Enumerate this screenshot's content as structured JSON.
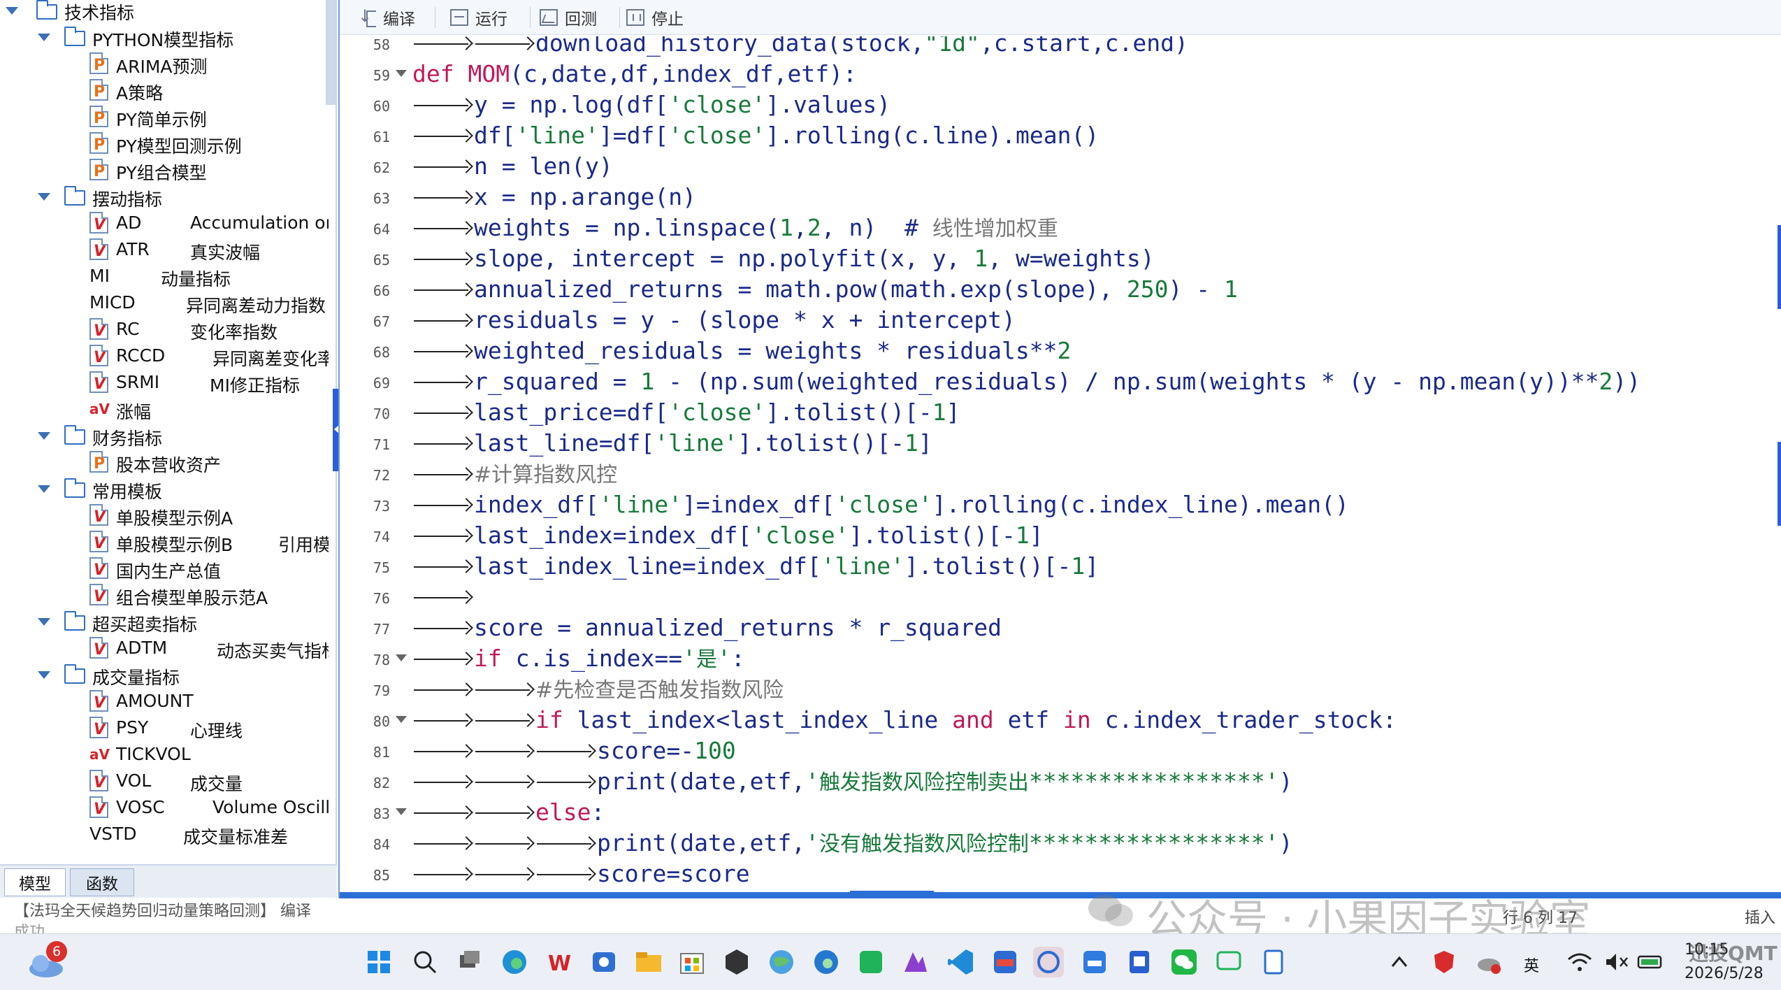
{
  "tree": {
    "root": "技术指标",
    "items": [
      {
        "kind": "folder",
        "level": 1,
        "label": "PYTHON模型指标"
      },
      {
        "kind": "file",
        "icon": "P",
        "label": "ARIMA预测"
      },
      {
        "kind": "file",
        "icon": "P",
        "label": "A策略"
      },
      {
        "kind": "file",
        "icon": "P",
        "label": "PY简单示例"
      },
      {
        "kind": "file",
        "icon": "P",
        "label": "PY模型回测示例"
      },
      {
        "kind": "file",
        "icon": "P",
        "label": "PY组合模型"
      },
      {
        "kind": "folder",
        "level": 1,
        "label": "摆动指标"
      },
      {
        "kind": "file",
        "icon": "V",
        "label": "AD",
        "desc": "Accumulation or"
      },
      {
        "kind": "file",
        "icon": "V",
        "label": "ATR",
        "desc": "真实波幅"
      },
      {
        "kind": "plain",
        "label": "MI",
        "desc": "动量指标"
      },
      {
        "kind": "plain",
        "label": "MICD",
        "desc": "异同离差动力指数"
      },
      {
        "kind": "file",
        "icon": "V",
        "label": "RC",
        "desc": "变化率指数"
      },
      {
        "kind": "file",
        "icon": "V",
        "label": "RCCD",
        "desc": "异同离差变化率"
      },
      {
        "kind": "file",
        "icon": "V",
        "label": "SRMI",
        "desc": "MI修正指标"
      },
      {
        "kind": "file",
        "icon": "aV",
        "label": "涨幅"
      },
      {
        "kind": "folder",
        "level": 1,
        "label": "财务指标"
      },
      {
        "kind": "file",
        "icon": "P",
        "label": "股本营收资产"
      },
      {
        "kind": "folder",
        "level": 1,
        "label": "常用模板"
      },
      {
        "kind": "file",
        "icon": "V",
        "label": "单股模型示例A"
      },
      {
        "kind": "file",
        "icon": "V",
        "label": "单股模型示例B",
        "desc": "引用模"
      },
      {
        "kind": "file",
        "icon": "V",
        "label": "国内生产总值"
      },
      {
        "kind": "file",
        "icon": "V",
        "label": "组合模型单股示范A"
      },
      {
        "kind": "folder",
        "level": 1,
        "label": "超买超卖指标"
      },
      {
        "kind": "file",
        "icon": "V",
        "label": "ADTM",
        "desc": "动态买卖气指标"
      },
      {
        "kind": "folder",
        "level": 1,
        "label": "成交量指标"
      },
      {
        "kind": "file",
        "icon": "V",
        "label": "AMOUNT"
      },
      {
        "kind": "file",
        "icon": "V",
        "label": "PSY",
        "desc": "心理线"
      },
      {
        "kind": "file",
        "icon": "aV",
        "label": "TICKVOL"
      },
      {
        "kind": "file",
        "icon": "V",
        "label": "VOL",
        "desc": "成交量"
      },
      {
        "kind": "file",
        "icon": "V",
        "label": "VOSC",
        "desc": "Volume Oscilla"
      },
      {
        "kind": "plain",
        "label": "VSTD",
        "desc": "成交量标准差"
      }
    ]
  },
  "left_tabs": [
    "模型",
    "函数"
  ],
  "toolbar": {
    "compile": "编译",
    "run": "运行",
    "backtest": "回测",
    "stop": "停止"
  },
  "code": [
    {
      "n": "58",
      "indent": 2,
      "text": "download_history_data(stock,\"1d\",c.start,c.end)"
    },
    {
      "n": "59",
      "indent": 0,
      "fold": true,
      "text": "def MOM(c,date,df,index_df,etf):"
    },
    {
      "n": "60",
      "indent": 1,
      "text": "y = np.log(df['close'].values)"
    },
    {
      "n": "61",
      "indent": 1,
      "text": "df['line']=df['close'].rolling(c.line).mean()"
    },
    {
      "n": "62",
      "indent": 1,
      "text": "n = len(y)"
    },
    {
      "n": "63",
      "indent": 1,
      "text": "x = np.arange(n)"
    },
    {
      "n": "64",
      "indent": 1,
      "text": "weights = np.linspace(1,2, n)  # ",
      "comment": "线性增加权重"
    },
    {
      "n": "65",
      "indent": 1,
      "text": "slope, intercept = np.polyfit(x, y, 1, w=weights)"
    },
    {
      "n": "66",
      "indent": 1,
      "text": "annualized_returns = math.pow(math.exp(slope), 250) - 1"
    },
    {
      "n": "67",
      "indent": 1,
      "text": "residuals = y - (slope * x + intercept)"
    },
    {
      "n": "68",
      "indent": 1,
      "text": "weighted_residuals = weights * residuals**2"
    },
    {
      "n": "69",
      "indent": 1,
      "text": "r_squared = 1 - (np.sum(weighted_residuals) / np.sum(weights * (y - np.mean(y))**2))"
    },
    {
      "n": "70",
      "indent": 1,
      "text": "last_price=df['close'].tolist()[-1]"
    },
    {
      "n": "71",
      "indent": 1,
      "text": "last_line=df['line'].tolist()[-1]"
    },
    {
      "n": "72",
      "indent": 1,
      "text": "",
      "comment": "#计算指数风控"
    },
    {
      "n": "73",
      "indent": 1,
      "text": "index_df['line']=index_df['close'].rolling(c.index_line).mean()"
    },
    {
      "n": "74",
      "indent": 1,
      "text": "last_index=index_df['close'].tolist()[-1]"
    },
    {
      "n": "75",
      "indent": 1,
      "text": "last_index_line=index_df['line'].tolist()[-1]"
    },
    {
      "n": "76",
      "indent": 1,
      "text": ""
    },
    {
      "n": "77",
      "indent": 1,
      "text": "score = annualized_returns * r_squared"
    },
    {
      "n": "78",
      "indent": 1,
      "fold": true,
      "text": "if c.is_index=='是':"
    },
    {
      "n": "79",
      "indent": 2,
      "text": "",
      "comment": "#先检查是否触发指数风险"
    },
    {
      "n": "80",
      "indent": 2,
      "fold": true,
      "text": "if last_index<last_index_line and etf in c.index_trader_stock:"
    },
    {
      "n": "81",
      "indent": 3,
      "text": "score=-100"
    },
    {
      "n": "82",
      "indent": 3,
      "text": "print(date,etf,'触发指数风险控制卖出*****************')"
    },
    {
      "n": "83",
      "indent": 2,
      "fold": true,
      "text": "else:"
    },
    {
      "n": "84",
      "indent": 3,
      "text": "print(date,etf,'没有触发指数风险控制*****************')"
    },
    {
      "n": "85",
      "indent": 3,
      "text": "score=score"
    }
  ],
  "status": {
    "message": "【法玛全天候趋势回归动量策略回测】 编译",
    "message2": "成功",
    "position": "行 6     列 17",
    "insert": "插入"
  },
  "watermark": "公众号 · 小果因子实验室",
  "taskbar": {
    "weather_badge": "6",
    "ime": "英",
    "time": "10:15",
    "date": "2026/5/28",
    "brand": "迅投QMT"
  }
}
